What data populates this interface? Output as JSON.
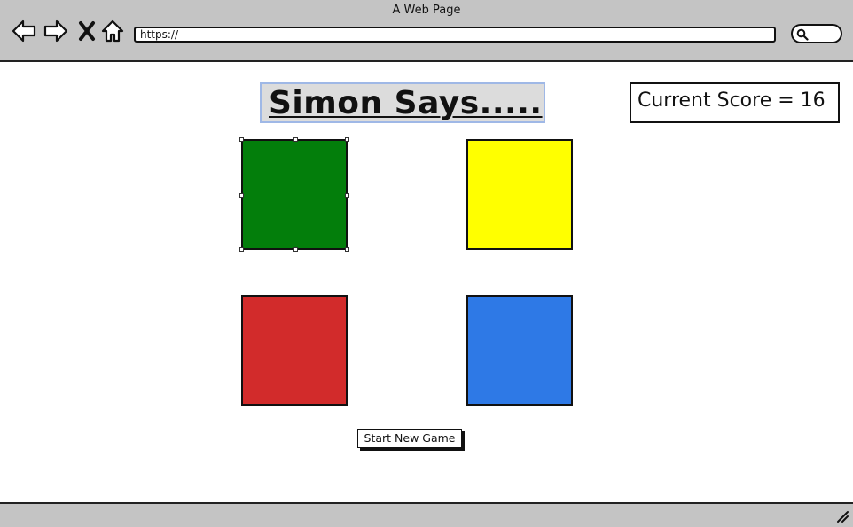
{
  "window": {
    "title": "A Web Page"
  },
  "toolbar": {
    "icons": [
      "back-arrow-icon",
      "forward-arrow-icon",
      "close-icon",
      "home-icon"
    ],
    "url": "https://",
    "search_icon": "search-icon"
  },
  "game": {
    "title": "Simon Says.....",
    "score_text": "Current Score = 16",
    "pads": [
      {
        "name": "green",
        "color": "#037e0b",
        "selected": true
      },
      {
        "name": "yellow",
        "color": "#ffff00",
        "selected": false
      },
      {
        "name": "red",
        "color": "#d22b2b",
        "selected": false
      },
      {
        "name": "blue",
        "color": "#2e79e6",
        "selected": false
      }
    ],
    "start_button_label": "Start New Game"
  }
}
